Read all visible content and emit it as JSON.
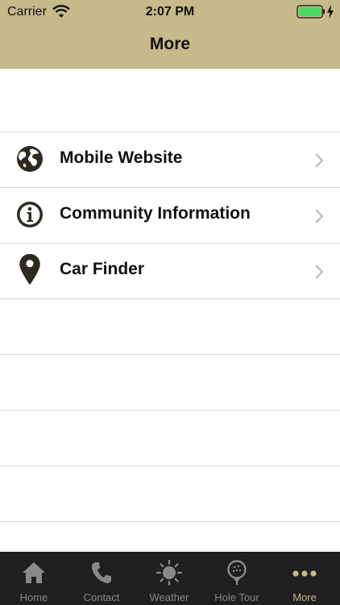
{
  "status_bar": {
    "carrier": "Carrier",
    "time": "2:07 PM"
  },
  "nav": {
    "title": "More"
  },
  "menu": {
    "items": [
      {
        "label": "Mobile Website",
        "icon": "globe-icon"
      },
      {
        "label": "Community Information",
        "icon": "info-icon"
      },
      {
        "label": "Car Finder",
        "icon": "map-pin-icon"
      }
    ]
  },
  "tabbar": {
    "tabs": [
      {
        "label": "Home",
        "icon": "home-icon"
      },
      {
        "label": "Contact",
        "icon": "phone-icon"
      },
      {
        "label": "Weather",
        "icon": "sun-icon"
      },
      {
        "label": "Hole Tour",
        "icon": "golf-ball-icon"
      },
      {
        "label": "More",
        "icon": "more-dots-icon",
        "active": true
      }
    ]
  },
  "colors": {
    "accent": "#c6b98a",
    "icon_dark": "#2e2a20",
    "tabbar_bg": "#1f1f1f",
    "battery": "#4cd964"
  }
}
